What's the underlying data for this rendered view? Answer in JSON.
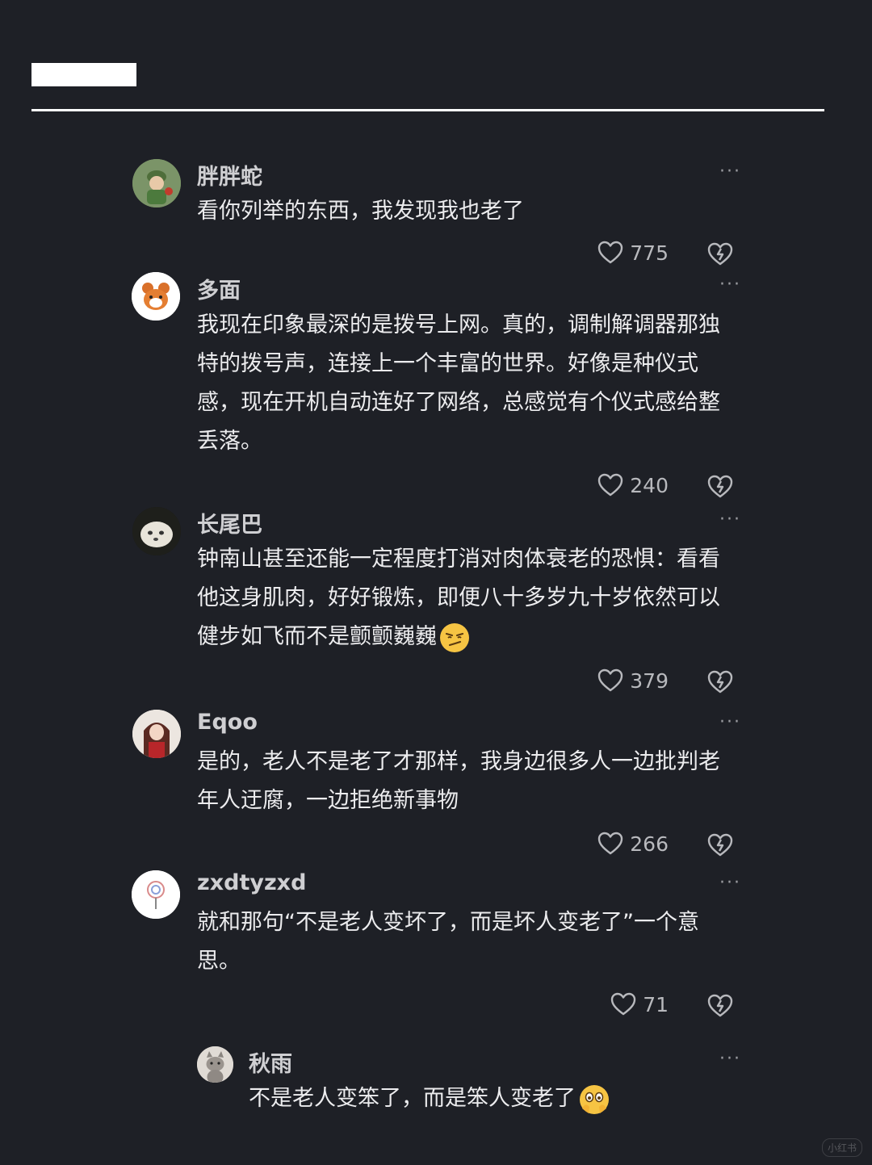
{
  "comments": [
    {
      "username": "胖胖蛇",
      "text": "看你列举的东西，我发现我也老了",
      "likes": "775",
      "avatar": "green-cartoon-character-avatar"
    },
    {
      "username": "多面",
      "text": "我现在印象最深的是拨号上网。真的，调制解调器那独特的拨号声，连接上一个丰富的世界。好像是种仪式感，现在开机自动连好了网络，总感觉有个仪式感给整丢落。",
      "likes": "240",
      "avatar": "orange-hamster-avatar"
    },
    {
      "username": "长尾巴",
      "text": "钟南山甚至还能一定程度打消对肉体衰老的恐惧：看看他这身肌肉，好好锻炼，即便八十多岁九十岁依然可以健步如飞而不是颤颤巍巍",
      "emoji": "smirk-face-emoji",
      "likes": "379",
      "avatar": "white-dog-avatar"
    },
    {
      "username": "Eqoo",
      "text": "是的，老人不是老了才那样，我身边很多人一边批判老年人迂腐，一边拒绝新事物",
      "likes": "266",
      "avatar": "anime-girl-avatar"
    },
    {
      "username": "zxdtyzxd",
      "text": "就和那句“不是老人变坏了，而是坏人变老了”一个意思。",
      "likes": "71",
      "avatar": "lollipop-avatar"
    }
  ],
  "reply": {
    "username": "秋雨",
    "text": "不是老人变笨了，而是笨人变老了",
    "emoji": "peeking-face-emoji",
    "avatar": "grey-cat-avatar"
  },
  "icons": {
    "more": "more-options-icon",
    "like": "heart-icon",
    "dislike": "broken-heart-icon"
  },
  "watermark": "小红书",
  "colors": {
    "background": "#1e2026",
    "text": "#ececee",
    "muted": "#b8b9bd"
  }
}
